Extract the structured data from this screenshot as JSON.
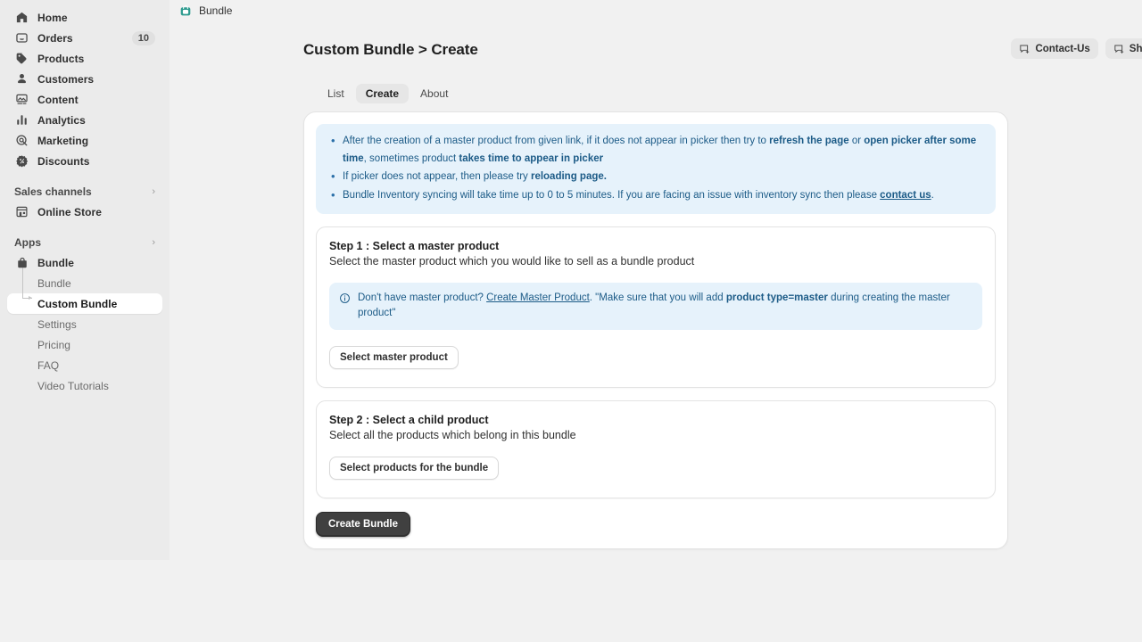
{
  "topbar": {
    "app_name": "Bundle",
    "icon": "shopping-bag-icon"
  },
  "sidebar": {
    "items": [
      {
        "label": "Home",
        "icon": "home-icon",
        "badge": ""
      },
      {
        "label": "Orders",
        "icon": "orders-icon",
        "badge": "10"
      },
      {
        "label": "Products",
        "icon": "products-tag-icon",
        "badge": ""
      },
      {
        "label": "Customers",
        "icon": "customers-person-icon",
        "badge": ""
      },
      {
        "label": "Content",
        "icon": "content-image-icon",
        "badge": ""
      },
      {
        "label": "Analytics",
        "icon": "analytics-bars-icon",
        "badge": ""
      },
      {
        "label": "Marketing",
        "icon": "marketing-target-icon",
        "badge": ""
      },
      {
        "label": "Discounts",
        "icon": "discounts-percent-icon",
        "badge": ""
      }
    ],
    "sales_channels": {
      "label": "Sales channels",
      "chevron": "›"
    },
    "online_store": {
      "label": "Online Store",
      "icon": "store-icon"
    },
    "apps": {
      "label": "Apps",
      "chevron": "›"
    },
    "app_group": {
      "label": "Bundle",
      "icon": "shopping-bag-icon"
    },
    "app_items": [
      {
        "label": "Bundle",
        "active": false
      },
      {
        "label": "Custom Bundle",
        "active": true
      },
      {
        "label": "Settings",
        "active": false
      },
      {
        "label": "Pricing",
        "active": false
      },
      {
        "label": "FAQ",
        "active": false
      },
      {
        "label": "Video Tutorials",
        "active": false
      }
    ]
  },
  "header": {
    "title": "Custom Bundle > Create",
    "contact_label": "Contact-Us",
    "feedback_label": "Share Feedback"
  },
  "tabs": [
    {
      "label": "List",
      "active": false
    },
    {
      "label": "Create",
      "active": true
    },
    {
      "label": "About",
      "active": false
    }
  ],
  "banner": {
    "bullet1": {
      "p1": "After the creation of a master product from given link, if it does not appear in picker then try to ",
      "b1": "refresh the page",
      "p2": " or ",
      "b2": "open picker after some time",
      "p3": ", sometimes product ",
      "b3": "takes time to appear in picker"
    },
    "bullet2": {
      "p1": "If picker does not appear, then please try ",
      "b1": "reloading page."
    },
    "bullet3": {
      "p1": "Bundle Inventory syncing will take time up to 0 to 5 minutes. If you are facing an issue with inventory sync then please ",
      "link": "contact us",
      "p2": "."
    }
  },
  "step1": {
    "title": "Step 1 : Select a master product",
    "subtitle": "Select the master product which you would like to sell as a bundle product",
    "note": {
      "p1": "Don't have master product? ",
      "link": "Create Master Product",
      "p2": ". \"Make sure that you will add ",
      "bold": "product type=master",
      "p3": " during creating the master product\""
    },
    "button": "Select master product"
  },
  "step2": {
    "title": "Step 2 : Select a child product",
    "subtitle": "Select all the products which belong in this bundle",
    "button": "Select products for the bundle"
  },
  "submit": {
    "label": "Create Bundle"
  },
  "colors": {
    "sidebar_bg": "#ebebeb",
    "page_bg": "#f1f1f1",
    "banner_bg": "#e6f2fb",
    "banner_text": "#1c5b87",
    "primary_btn": "#404040",
    "brand_teal": "#2e9b8f"
  }
}
